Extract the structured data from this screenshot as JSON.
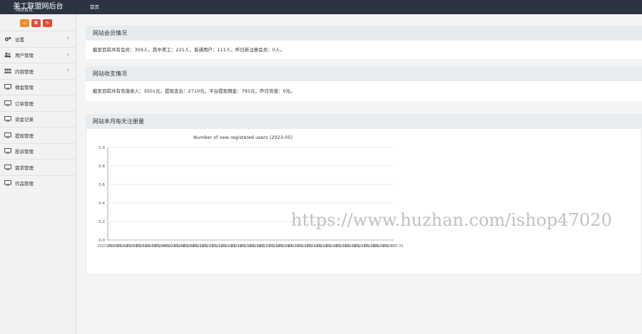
{
  "header": {
    "brand": "美工联盟网后台",
    "brand_sub": "网站首页",
    "nav_home": "首页"
  },
  "quick_buttons": [
    "home-icon",
    "user-icon",
    "refresh-icon"
  ],
  "sidebar": {
    "items": [
      {
        "label": "设置",
        "icon": "gear-icon"
      },
      {
        "label": "用户管理",
        "icon": "users-icon"
      },
      {
        "label": "内容管理",
        "icon": "grid-icon"
      },
      {
        "label": "佣金管理",
        "icon": "monitor-icon"
      },
      {
        "label": "订单管理",
        "icon": "monitor-icon"
      },
      {
        "label": "资金记录",
        "icon": "monitor-icon"
      },
      {
        "label": "提现管理",
        "icon": "monitor-icon"
      },
      {
        "label": "投诉管理",
        "icon": "monitor-icon"
      },
      {
        "label": "需求管理",
        "icon": "monitor-icon"
      },
      {
        "label": "作品管理",
        "icon": "monitor-icon"
      }
    ]
  },
  "panels": {
    "members": {
      "title": "网站会员情况",
      "text": "截至目前共有会员：359人，其中美工：221人，普通用户：111人，昨日新注册会员：0人。"
    },
    "finance": {
      "title": "网站收支情况",
      "text": "截至目前共有充值收入：3501元，提现支出：2710元，平台提现佣金：791元，昨日充值：0元。"
    },
    "registrations": {
      "title": "网站本月每天注册量"
    }
  },
  "chart_data": {
    "type": "line",
    "title": "Number of new registered users (2023-05)",
    "x": [
      "2023-05-01",
      "2023-05-02",
      "2023-05-03",
      "2023-05-04",
      "2023-05-05",
      "2023-05-06",
      "2023-05-07",
      "2023-05-08",
      "2023-05-09",
      "2023-05-10",
      "2023-05-11",
      "2023-05-12",
      "2023-05-13",
      "2023-05-14",
      "2023-05-15",
      "2023-05-16",
      "2023-05-17",
      "2023-05-18",
      "2023-05-19",
      "2023-05-20",
      "2023-05-21",
      "2023-05-22",
      "2023-05-23",
      "2023-05-24",
      "2023-05-25",
      "2023-05-26",
      "2023-05-27",
      "2023-05-28",
      "2023-05-29",
      "2023-05-30",
      "2023-05-31"
    ],
    "values": [
      0,
      0,
      0,
      0,
      0,
      0,
      0,
      0,
      0,
      0,
      0,
      0,
      0,
      0,
      0,
      0,
      0,
      0,
      0,
      0,
      0,
      0,
      0,
      0,
      0,
      0,
      0,
      0,
      0,
      0,
      0
    ],
    "ylim": [
      0,
      1.0
    ],
    "yticks": [
      "0.0",
      "0.2",
      "0.4",
      "0.6",
      "0.8",
      "1.0"
    ],
    "grid": true
  },
  "watermark": "https://www.huzhan.com/ishop47020"
}
